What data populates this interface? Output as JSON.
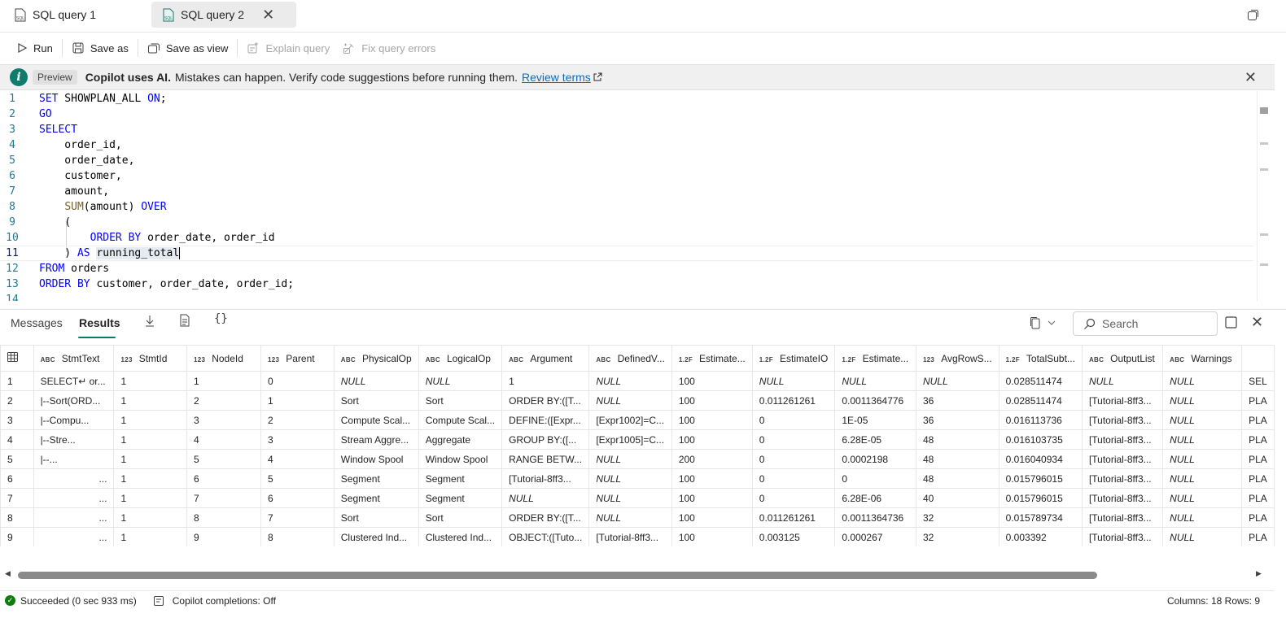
{
  "tabs": [
    {
      "label": "SQL query 1",
      "active": false
    },
    {
      "label": "SQL query 2",
      "active": true
    }
  ],
  "toolbar": {
    "run": "Run",
    "save_as": "Save as",
    "save_as_view": "Save as view",
    "explain_query": "Explain query",
    "fix_query_errors": "Fix query errors"
  },
  "banner": {
    "preview": "Preview",
    "strong": "Copilot uses AI.",
    "text": "Mistakes can happen. Verify code suggestions before running them.",
    "link": "Review terms"
  },
  "editor": {
    "line_numbers": [
      "1",
      "2",
      "3",
      "4",
      "5",
      "6",
      "7",
      "8",
      "9",
      "10",
      "11",
      "12",
      "13",
      "14"
    ],
    "current_line": 11
  },
  "results": {
    "tab_messages": "Messages",
    "tab_results": "Results",
    "search_placeholder": "Search"
  },
  "grid": {
    "columns": [
      {
        "type": "ABC",
        "name": "StmtText"
      },
      {
        "type": "123",
        "name": "StmtId"
      },
      {
        "type": "123",
        "name": "NodeId"
      },
      {
        "type": "123",
        "name": "Parent"
      },
      {
        "type": "ABC",
        "name": "PhysicalOp"
      },
      {
        "type": "ABC",
        "name": "LogicalOp"
      },
      {
        "type": "ABC",
        "name": "Argument"
      },
      {
        "type": "ABC",
        "name": "DefinedV..."
      },
      {
        "type": "1.2F",
        "name": "Estimate..."
      },
      {
        "type": "1.2F",
        "name": "EstimateIO"
      },
      {
        "type": "1.2F",
        "name": "Estimate..."
      },
      {
        "type": "123",
        "name": "AvgRowS..."
      },
      {
        "type": "1.2F",
        "name": "TotalSubt..."
      },
      {
        "type": "ABC",
        "name": "OutputList"
      },
      {
        "type": "ABC",
        "name": "Warnings"
      },
      {
        "type": "",
        "name": ""
      }
    ],
    "rows": [
      [
        "1",
        "SELECT↵    or...",
        "1",
        "1",
        "0",
        "NULL",
        "NULL",
        "1",
        "NULL",
        "100",
        "NULL",
        "NULL",
        "NULL",
        "0.028511474",
        "NULL",
        "NULL",
        "SEL"
      ],
      [
        "2",
        "  |--Sort(ORD...",
        "1",
        "2",
        "1",
        "Sort",
        "Sort",
        "ORDER BY:([T...",
        "NULL",
        "100",
        "0.011261261",
        "0.0011364776",
        "36",
        "0.028511474",
        "[Tutorial-8ff3...",
        "NULL",
        "PLA"
      ],
      [
        "3",
        "       |--Compu...",
        "1",
        "3",
        "2",
        "Compute Scal...",
        "Compute Scal...",
        "DEFINE:([Expr...",
        "[Expr1002]=C...",
        "100",
        "0",
        "1E-05",
        "36",
        "0.016113736",
        "[Tutorial-8ff3...",
        "NULL",
        "PLA"
      ],
      [
        "4",
        "            |--Stre...",
        "1",
        "4",
        "3",
        "Stream Aggre...",
        "Aggregate",
        "GROUP BY:([...",
        "[Expr1005]=C...",
        "100",
        "0",
        "6.28E-05",
        "48",
        "0.016103735",
        "[Tutorial-8ff3...",
        "NULL",
        "PLA"
      ],
      [
        "5",
        "                 |--...",
        "1",
        "5",
        "4",
        "Window Spool",
        "Window Spool",
        "RANGE BETW...",
        "NULL",
        "200",
        "0",
        "0.0002198",
        "48",
        "0.016040934",
        "[Tutorial-8ff3...",
        "NULL",
        "PLA"
      ],
      [
        "6",
        "...",
        "1",
        "6",
        "5",
        "Segment",
        "Segment",
        "[Tutorial-8ff3...",
        "NULL",
        "100",
        "0",
        "0",
        "48",
        "0.015796015",
        "[Tutorial-8ff3...",
        "NULL",
        "PLA"
      ],
      [
        "7",
        "...",
        "1",
        "7",
        "6",
        "Segment",
        "Segment",
        "NULL",
        "NULL",
        "100",
        "0",
        "6.28E-06",
        "40",
        "0.015796015",
        "[Tutorial-8ff3...",
        "NULL",
        "PLA"
      ],
      [
        "8",
        "...",
        "1",
        "8",
        "7",
        "Sort",
        "Sort",
        "ORDER BY:([T...",
        "NULL",
        "100",
        "0.011261261",
        "0.0011364736",
        "32",
        "0.015789734",
        "[Tutorial-8ff3...",
        "NULL",
        "PLA"
      ],
      [
        "9",
        "...",
        "1",
        "9",
        "8",
        "Clustered Ind...",
        "Clustered Ind...",
        "OBJECT:([Tuto...",
        "[Tutorial-8ff3...",
        "100",
        "0.003125",
        "0.000267",
        "32",
        "0.003392",
        "[Tutorial-8ff3...",
        "NULL",
        "PLA"
      ]
    ]
  },
  "status": {
    "result": "Succeeded (0 sec 933 ms)",
    "copilot": "Copilot completions: Off",
    "summary": "Columns: 18 Rows: 9"
  },
  "icons": [
    "sql-file-icon",
    "close-icon",
    "restore-icon",
    "run-icon",
    "save-icon",
    "save-view-icon",
    "explain-icon",
    "fix-icon",
    "copilot-icon",
    "external-link-icon",
    "download-icon",
    "document-icon",
    "braces-icon",
    "copy-icon",
    "chevron-down-icon",
    "search-icon",
    "maximize-icon",
    "success-icon"
  ],
  "colors": {
    "accent": "#117865",
    "keyword": "#0000ff",
    "function": "#795e26",
    "line_number": "#237893",
    "link": "#0f6cbd",
    "success": "#107c10"
  }
}
